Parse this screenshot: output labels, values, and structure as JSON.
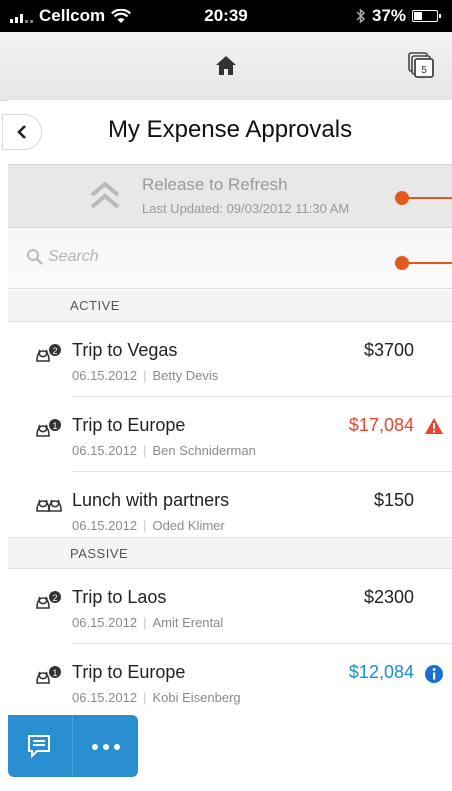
{
  "status": {
    "carrier": "Cellcom",
    "time": "20:39",
    "battery": "37%"
  },
  "nav": {
    "home_icon": "home-icon",
    "stack_icon": "stack-icon",
    "stack_count": "5"
  },
  "header": {
    "title": "My Expense Approvals"
  },
  "refresh": {
    "label": "Release to Refresh",
    "last_updated": "Last Updated: 09/03/2012 11:30 AM"
  },
  "search": {
    "placeholder": "Search"
  },
  "sections": {
    "active": "ACTIVE",
    "passive": "PASSIVE"
  },
  "active_items": [
    {
      "name": "Trip to Vegas",
      "date": "06.15.2012",
      "person": "Betty Devis",
      "amount": "$3700",
      "approvers": "2"
    },
    {
      "name": "Trip to Europe",
      "date": "06.15.2012",
      "person": "Ben Schniderman",
      "amount": "$17,084",
      "approvers": "1",
      "alert": "warning-icon"
    },
    {
      "name": "Lunch with partners",
      "date": "06.15.2012",
      "person": "Oded Klimer",
      "amount": "$150",
      "approvers": ""
    }
  ],
  "passive_items": [
    {
      "name": "Trip to Laos",
      "date": "06.15.2012",
      "person": "Amit Erental",
      "amount": "$2300",
      "approvers": "2"
    },
    {
      "name": "Trip to Europe",
      "date": "06.15.2012",
      "person": "Kobi Eisenberg",
      "amount": "$12,084",
      "approvers": "1",
      "alert": "info-icon"
    }
  ],
  "colors": {
    "accent_orange": "#e35a1f",
    "alert_red": "#e8452c",
    "info_blue": "#1a8fcf",
    "toolbar_blue": "#2a8fd0"
  }
}
